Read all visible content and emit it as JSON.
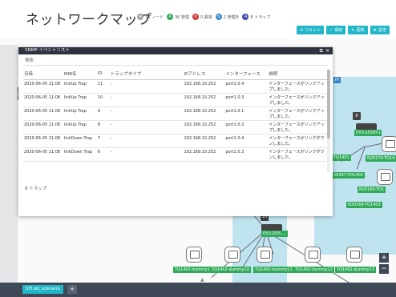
{
  "header": {
    "title": "ネットワークマップ",
    "stats": [
      {
        "icon": "node-count-icon",
        "badge": "⊕",
        "text": "38 ノード",
        "color": "#9aa0a6"
      },
      {
        "icon": "normal-status-icon",
        "badge": "A",
        "text": "36 管理",
        "color": "#2faa58"
      },
      {
        "icon": "error-status-icon",
        "badge": "V",
        "text": "0 異常",
        "color": "#d33838"
      },
      {
        "icon": "unmanaged-icon",
        "badge": "⇆",
        "text": "2 管理外",
        "color": "#3a86c8"
      },
      {
        "icon": "trap-icon",
        "badge": "A",
        "text": "8 トラップ",
        "color": "#3d47b0"
      }
    ],
    "toolbar": [
      {
        "name": "reset-button",
        "icon": "⟲",
        "label": "リセット"
      },
      {
        "name": "save-button",
        "icon": "✓",
        "label": "保存"
      },
      {
        "name": "refresh-button",
        "icon": "↻",
        "label": "更新"
      },
      {
        "name": "settings-button",
        "icon": "⚙",
        "label": "設定"
      }
    ]
  },
  "dialog": {
    "title": "SNMP イベントリスト",
    "search_placeholder": "検索",
    "columns": [
      "日時",
      "MIB名",
      "ID",
      "トラップタイプ",
      "IPアドレス",
      "インターフェース",
      "説明"
    ],
    "rows": [
      [
        "2020-06-05 11:08",
        "linkUp Trap",
        "11",
        "-",
        "192.168.10.252",
        "port1.0.4",
        "インターフェースがリンクアップしました。"
      ],
      [
        "2020-06-05 11:08",
        "linkUp Trap",
        "10",
        "-",
        "192.168.10.252",
        "port1.0.3",
        "インターフェースがリンクアップしました。"
      ],
      [
        "2020-06-05 11:08",
        "linkUp Trap",
        "9",
        "-",
        "192.168.10.252",
        "port1.0.1",
        "インターフェースがリンクアップしました。"
      ],
      [
        "2020-06-05 11:08",
        "linkUp Trap",
        "8",
        "-",
        "192.168.10.252",
        "port1.0.2",
        "インターフェースがリンクアップしました。"
      ],
      [
        "2020-06-05 11:08",
        "linkDown Trap",
        "7",
        "-",
        "192.168.10.252",
        "port1.0.4",
        "インターフェースがリンクダウンしました。"
      ],
      [
        "2020-06-05 11:08",
        "linkDown Trap",
        "6",
        "-",
        "192.168.10.252",
        "port1.0.3",
        "インターフェースがリンクダウンしました。"
      ]
    ],
    "footer": "8 トラップ"
  },
  "map": {
    "switch_count_main": "10",
    "switch_count_right": "6",
    "switch_label_main": "EX3-DX5-...",
    "switch_label_right": "EX3-x5505-l",
    "device_labels": [
      "TQ1402-dummy1",
      "TQ1402-dummy10",
      "TQ1402-dummy11",
      "TQ1402-dummy12",
      "TQ1402-dummy13"
    ],
    "right_labels": [
      "TQ1401",
      "N20170-TQ14",
      "20167-TQ1402",
      "N20169-TQ1",
      "N20168-TQ1402"
    ],
    "ip_fragment": "IP"
  },
  "bottom": {
    "scenario_tab": "SFI.ab_scenario",
    "add_tab": "+"
  },
  "zoom": {
    "in": "+",
    "out": "−"
  }
}
